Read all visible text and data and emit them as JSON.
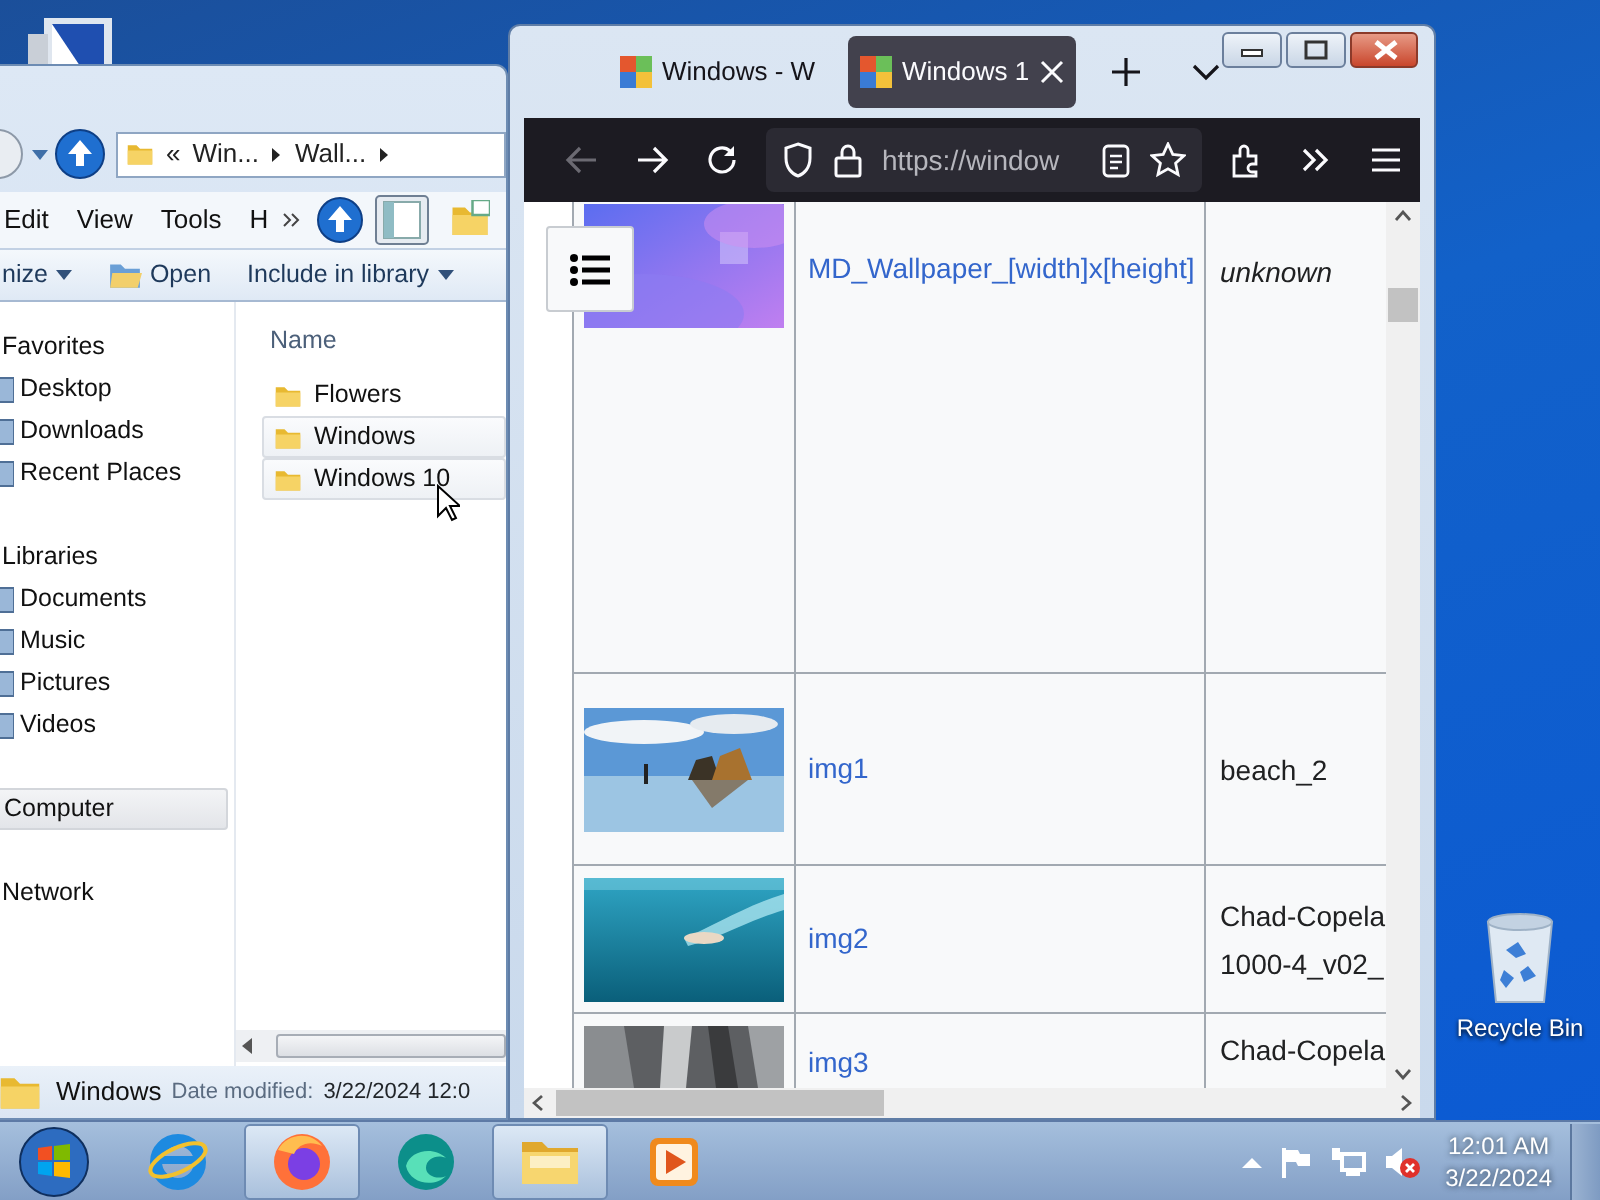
{
  "desktop": {
    "icons": [
      {
        "label": "Recycle Bin"
      }
    ]
  },
  "explorer": {
    "address": {
      "chevron": "«",
      "crumbs": [
        "Win...",
        "Wall..."
      ]
    },
    "menu": [
      "Edit",
      "View",
      "Tools",
      "H"
    ],
    "toolbar": [
      {
        "label": "nize",
        "dropdown": true
      },
      {
        "label": "Open",
        "dropdown": false
      },
      {
        "label": "Include in library",
        "dropdown": true
      }
    ],
    "nav": [
      {
        "label": "Favorites",
        "selected": false,
        "children": [
          {
            "label": "Desktop"
          },
          {
            "label": "Downloads"
          },
          {
            "label": "Recent Places"
          }
        ]
      },
      {
        "label": "Libraries",
        "selected": false,
        "children": [
          {
            "label": "Documents"
          },
          {
            "label": "Music"
          },
          {
            "label": "Pictures"
          },
          {
            "label": "Videos"
          }
        ]
      },
      {
        "label": "Computer",
        "selected": true
      },
      {
        "label": "Network",
        "selected": false
      }
    ],
    "list_header": "Name",
    "files": [
      {
        "name": "Flowers",
        "highlighted": false
      },
      {
        "name": "Windows",
        "highlighted": true
      },
      {
        "name": "Windows 10",
        "highlighted": true
      }
    ],
    "status": {
      "name": "Windows",
      "label": "Date modified:",
      "value": "3/22/2024 12:0"
    }
  },
  "browser": {
    "tabs": [
      {
        "title": "Windows - W",
        "selected": false
      },
      {
        "title": "Windows 1",
        "selected": true
      }
    ],
    "url": "https://window",
    "rows": [
      {
        "kind": "unknown",
        "link": "MD_Wallpaper_[width]x[height]",
        "author": [
          "unknown"
        ]
      },
      {
        "kind": "known",
        "link": "img1",
        "author": [
          "beach_2"
        ]
      },
      {
        "kind": "known",
        "link": "img2",
        "author": [
          "Chad-Copela",
          "1000-4_v02_"
        ]
      },
      {
        "kind": "known",
        "link": "img3",
        "author": [
          "Chad-Copela"
        ]
      }
    ]
  },
  "taskbar": {
    "apps": [
      {
        "kind": "e-browser",
        "active": false
      },
      {
        "kind": "fox-browser",
        "active": true
      },
      {
        "kind": "wave-browser",
        "active": false
      },
      {
        "kind": "folder",
        "active": true
      },
      {
        "kind": "player",
        "active": false
      }
    ],
    "clock": {
      "time": "12:01 AM",
      "date": "3/22/2024"
    }
  }
}
